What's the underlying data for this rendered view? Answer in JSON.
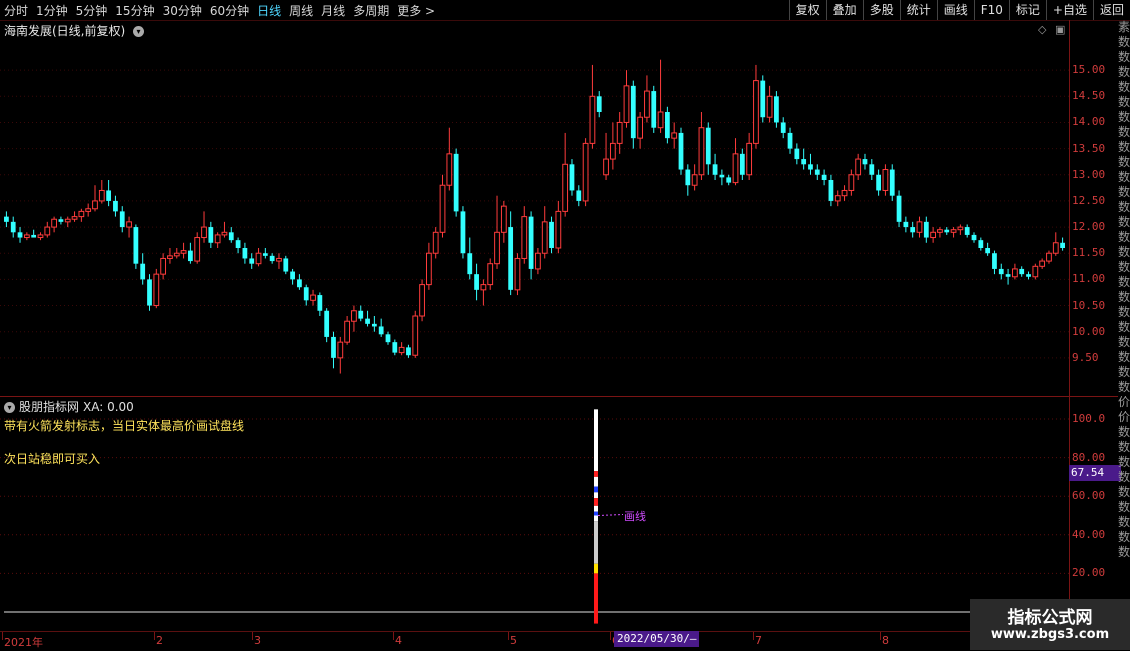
{
  "toolbar": {
    "periods": [
      "分时",
      "1分钟",
      "5分钟",
      "15分钟",
      "30分钟",
      "60分钟",
      "日线",
      "周线",
      "月线",
      "多周期",
      "更多 >"
    ],
    "active_period": "日线",
    "buttons": [
      "复权",
      "叠加",
      "多股",
      "统计",
      "画线",
      "F10",
      "标记",
      "+自选",
      "返回"
    ]
  },
  "main": {
    "title": "海南发展(日线,前复权)",
    "price_labels": [
      "15.00",
      "14.50",
      "14.00",
      "13.50",
      "13.00",
      "12.50",
      "12.00",
      "11.50",
      "11.00",
      "10.50",
      "10.00",
      "9.50"
    ],
    "up_color": "#ff3c3c",
    "down_color": "#33ffff"
  },
  "indicator": {
    "name": "股朋指标网",
    "xa_label": "XA: 0.00",
    "line1": "带有火箭发射标志，当日实体最高价画试盘线",
    "line2": "次日站稳即可买入",
    "axis_labels": [
      "100.0",
      "80.00",
      "60.00",
      "40.00",
      "20.00"
    ],
    "current_value": "67.54",
    "trial_line_label": "画线"
  },
  "date_axis": {
    "labels": [
      "2021年",
      "2",
      "3",
      "4",
      "5",
      "6",
      "7",
      "8"
    ],
    "crosshair_date": "2022/05/30/—"
  },
  "right_strip": [
    "素",
    "数",
    "数",
    "数",
    "数",
    "数",
    "数",
    "数",
    "数",
    "数",
    "数",
    "数",
    "数",
    "数",
    "数",
    "数",
    "数",
    "数",
    "数",
    "数",
    "数",
    "数",
    "数",
    "数",
    "数",
    "价",
    "价",
    "数",
    "数",
    "数",
    "数",
    "数",
    "数",
    "数",
    "数",
    "数"
  ],
  "watermark": {
    "title": "指标公式网",
    "url": "www.zbgs3.com"
  },
  "chart_data": {
    "type": "candlestick",
    "title": "海南发展(日线,前复权)",
    "ylim": [
      9.0,
      15.5
    ],
    "candles": [
      {
        "o": 12.2,
        "h": 12.3,
        "l": 12.0,
        "c": 12.1
      },
      {
        "o": 12.1,
        "h": 12.2,
        "l": 11.8,
        "c": 11.9
      },
      {
        "o": 11.9,
        "h": 12.0,
        "l": 11.7,
        "c": 11.8
      },
      {
        "o": 11.8,
        "h": 11.9,
        "l": 11.75,
        "c": 11.85
      },
      {
        "o": 11.85,
        "h": 11.95,
        "l": 11.8,
        "c": 11.8
      },
      {
        "o": 11.8,
        "h": 11.9,
        "l": 11.75,
        "c": 11.85
      },
      {
        "o": 11.85,
        "h": 12.1,
        "l": 11.8,
        "c": 12.0
      },
      {
        "o": 12.0,
        "h": 12.2,
        "l": 11.9,
        "c": 12.15
      },
      {
        "o": 12.15,
        "h": 12.2,
        "l": 12.05,
        "c": 12.1
      },
      {
        "o": 12.1,
        "h": 12.2,
        "l": 12.0,
        "c": 12.15
      },
      {
        "o": 12.15,
        "h": 12.3,
        "l": 12.1,
        "c": 12.2
      },
      {
        "o": 12.2,
        "h": 12.35,
        "l": 12.1,
        "c": 12.3
      },
      {
        "o": 12.3,
        "h": 12.45,
        "l": 12.2,
        "c": 12.35
      },
      {
        "o": 12.35,
        "h": 12.8,
        "l": 12.3,
        "c": 12.5
      },
      {
        "o": 12.5,
        "h": 12.9,
        "l": 12.45,
        "c": 12.7
      },
      {
        "o": 12.7,
        "h": 12.9,
        "l": 12.4,
        "c": 12.5
      },
      {
        "o": 12.5,
        "h": 12.6,
        "l": 12.2,
        "c": 12.3
      },
      {
        "o": 12.3,
        "h": 12.4,
        "l": 11.9,
        "c": 12.0
      },
      {
        "o": 12.0,
        "h": 12.2,
        "l": 11.8,
        "c": 12.1
      },
      {
        "o": 12.0,
        "h": 12.05,
        "l": 11.2,
        "c": 11.3
      },
      {
        "o": 11.3,
        "h": 11.5,
        "l": 10.9,
        "c": 11.0
      },
      {
        "o": 11.0,
        "h": 11.1,
        "l": 10.4,
        "c": 10.5
      },
      {
        "o": 10.5,
        "h": 11.2,
        "l": 10.45,
        "c": 11.1
      },
      {
        "o": 11.1,
        "h": 11.5,
        "l": 11.0,
        "c": 11.4
      },
      {
        "o": 11.4,
        "h": 11.6,
        "l": 11.3,
        "c": 11.45
      },
      {
        "o": 11.45,
        "h": 11.6,
        "l": 11.4,
        "c": 11.5
      },
      {
        "o": 11.5,
        "h": 11.7,
        "l": 11.4,
        "c": 11.55
      },
      {
        "o": 11.55,
        "h": 11.7,
        "l": 11.3,
        "c": 11.35
      },
      {
        "o": 11.35,
        "h": 11.9,
        "l": 11.3,
        "c": 11.8
      },
      {
        "o": 11.8,
        "h": 12.3,
        "l": 11.7,
        "c": 12.0
      },
      {
        "o": 12.0,
        "h": 12.1,
        "l": 11.6,
        "c": 11.7
      },
      {
        "o": 11.7,
        "h": 11.9,
        "l": 11.6,
        "c": 11.85
      },
      {
        "o": 11.85,
        "h": 12.1,
        "l": 11.8,
        "c": 11.9
      },
      {
        "o": 11.9,
        "h": 12.0,
        "l": 11.7,
        "c": 11.75
      },
      {
        "o": 11.75,
        "h": 11.8,
        "l": 11.5,
        "c": 11.6
      },
      {
        "o": 11.6,
        "h": 11.7,
        "l": 11.3,
        "c": 11.4
      },
      {
        "o": 11.4,
        "h": 11.5,
        "l": 11.2,
        "c": 11.3
      },
      {
        "o": 11.3,
        "h": 11.6,
        "l": 11.25,
        "c": 11.5
      },
      {
        "o": 11.5,
        "h": 11.6,
        "l": 11.4,
        "c": 11.45
      },
      {
        "o": 11.45,
        "h": 11.5,
        "l": 11.3,
        "c": 11.35
      },
      {
        "o": 11.35,
        "h": 11.5,
        "l": 11.2,
        "c": 11.4
      },
      {
        "o": 11.4,
        "h": 11.45,
        "l": 11.1,
        "c": 11.15
      },
      {
        "o": 11.15,
        "h": 11.2,
        "l": 10.9,
        "c": 11.0
      },
      {
        "o": 11.0,
        "h": 11.1,
        "l": 10.8,
        "c": 10.85
      },
      {
        "o": 10.85,
        "h": 10.9,
        "l": 10.5,
        "c": 10.6
      },
      {
        "o": 10.6,
        "h": 10.8,
        "l": 10.5,
        "c": 10.7
      },
      {
        "o": 10.7,
        "h": 10.75,
        "l": 10.3,
        "c": 10.4
      },
      {
        "o": 10.4,
        "h": 10.45,
        "l": 9.8,
        "c": 9.9
      },
      {
        "o": 9.9,
        "h": 10.0,
        "l": 9.3,
        "c": 9.5
      },
      {
        "o": 9.5,
        "h": 9.9,
        "l": 9.2,
        "c": 9.8
      },
      {
        "o": 9.8,
        "h": 10.3,
        "l": 9.75,
        "c": 10.2
      },
      {
        "o": 10.2,
        "h": 10.5,
        "l": 10.0,
        "c": 10.4
      },
      {
        "o": 10.4,
        "h": 10.5,
        "l": 10.2,
        "c": 10.25
      },
      {
        "o": 10.25,
        "h": 10.4,
        "l": 10.1,
        "c": 10.15
      },
      {
        "o": 10.15,
        "h": 10.3,
        "l": 10.0,
        "c": 10.1
      },
      {
        "o": 10.1,
        "h": 10.25,
        "l": 9.9,
        "c": 9.95
      },
      {
        "o": 9.95,
        "h": 10.0,
        "l": 9.75,
        "c": 9.8
      },
      {
        "o": 9.8,
        "h": 9.85,
        "l": 9.55,
        "c": 9.6
      },
      {
        "o": 9.6,
        "h": 9.8,
        "l": 9.55,
        "c": 9.7
      },
      {
        "o": 9.7,
        "h": 9.75,
        "l": 9.5,
        "c": 9.55
      },
      {
        "o": 9.55,
        "h": 10.4,
        "l": 9.5,
        "c": 10.3
      },
      {
        "o": 10.3,
        "h": 11.0,
        "l": 10.2,
        "c": 10.9
      },
      {
        "o": 10.9,
        "h": 11.7,
        "l": 10.8,
        "c": 11.5
      },
      {
        "o": 11.5,
        "h": 12.0,
        "l": 11.4,
        "c": 11.9
      },
      {
        "o": 11.9,
        "h": 13.0,
        "l": 11.8,
        "c": 12.8
      },
      {
        "o": 12.8,
        "h": 13.9,
        "l": 12.7,
        "c": 13.4
      },
      {
        "o": 13.4,
        "h": 13.5,
        "l": 12.2,
        "c": 12.3
      },
      {
        "o": 12.3,
        "h": 12.4,
        "l": 11.4,
        "c": 11.5
      },
      {
        "o": 11.5,
        "h": 11.8,
        "l": 11.0,
        "c": 11.1
      },
      {
        "o": 11.1,
        "h": 11.3,
        "l": 10.6,
        "c": 10.8
      },
      {
        "o": 10.8,
        "h": 11.0,
        "l": 10.5,
        "c": 10.9
      },
      {
        "o": 10.9,
        "h": 11.4,
        "l": 10.8,
        "c": 11.3
      },
      {
        "o": 11.3,
        "h": 12.6,
        "l": 11.2,
        "c": 11.9
      },
      {
        "o": 11.9,
        "h": 12.5,
        "l": 11.7,
        "c": 12.4
      },
      {
        "o": 12.0,
        "h": 12.3,
        "l": 10.7,
        "c": 10.8
      },
      {
        "o": 10.8,
        "h": 11.5,
        "l": 10.7,
        "c": 11.4
      },
      {
        "o": 11.4,
        "h": 12.4,
        "l": 11.3,
        "c": 12.2
      },
      {
        "o": 12.2,
        "h": 12.3,
        "l": 11.0,
        "c": 11.2
      },
      {
        "o": 11.2,
        "h": 11.6,
        "l": 11.1,
        "c": 11.5
      },
      {
        "o": 11.5,
        "h": 12.4,
        "l": 11.4,
        "c": 12.1
      },
      {
        "o": 12.1,
        "h": 12.2,
        "l": 11.5,
        "c": 11.6
      },
      {
        "o": 11.6,
        "h": 12.5,
        "l": 11.5,
        "c": 12.3
      },
      {
        "o": 12.3,
        "h": 13.8,
        "l": 12.2,
        "c": 13.2
      },
      {
        "o": 13.2,
        "h": 13.3,
        "l": 12.6,
        "c": 12.7
      },
      {
        "o": 12.7,
        "h": 12.8,
        "l": 12.4,
        "c": 12.5
      },
      {
        "o": 12.5,
        "h": 13.7,
        "l": 12.4,
        "c": 13.6
      },
      {
        "o": 13.6,
        "h": 15.1,
        "l": 13.5,
        "c": 14.5
      },
      {
        "o": 14.5,
        "h": 14.6,
        "l": 14.1,
        "c": 14.2
      },
      {
        "o": 13.0,
        "h": 13.8,
        "l": 12.9,
        "c": 13.3
      },
      {
        "o": 13.3,
        "h": 14.0,
        "l": 13.1,
        "c": 13.6
      },
      {
        "o": 13.6,
        "h": 14.2,
        "l": 13.4,
        "c": 14.0
      },
      {
        "o": 14.0,
        "h": 15.0,
        "l": 13.9,
        "c": 14.7
      },
      {
        "o": 14.7,
        "h": 14.8,
        "l": 13.5,
        "c": 13.7
      },
      {
        "o": 13.7,
        "h": 14.2,
        "l": 13.5,
        "c": 14.1
      },
      {
        "o": 14.1,
        "h": 14.9,
        "l": 14.0,
        "c": 14.6
      },
      {
        "o": 14.6,
        "h": 14.7,
        "l": 13.8,
        "c": 13.9
      },
      {
        "o": 13.9,
        "h": 15.2,
        "l": 13.8,
        "c": 14.2
      },
      {
        "o": 14.2,
        "h": 14.3,
        "l": 13.6,
        "c": 13.7
      },
      {
        "o": 13.7,
        "h": 14.0,
        "l": 13.5,
        "c": 13.8
      },
      {
        "o": 13.8,
        "h": 13.9,
        "l": 13.0,
        "c": 13.1
      },
      {
        "o": 13.1,
        "h": 13.2,
        "l": 12.6,
        "c": 12.8
      },
      {
        "o": 12.8,
        "h": 13.2,
        "l": 12.7,
        "c": 13.0
      },
      {
        "o": 13.0,
        "h": 14.2,
        "l": 12.9,
        "c": 13.9
      },
      {
        "o": 13.9,
        "h": 14.0,
        "l": 13.0,
        "c": 13.2
      },
      {
        "o": 13.2,
        "h": 13.4,
        "l": 12.9,
        "c": 13.0
      },
      {
        "o": 13.0,
        "h": 13.1,
        "l": 12.8,
        "c": 12.95
      },
      {
        "o": 12.95,
        "h": 13.0,
        "l": 12.8,
        "c": 12.85
      },
      {
        "o": 12.85,
        "h": 13.7,
        "l": 12.8,
        "c": 13.4
      },
      {
        "o": 13.4,
        "h": 13.5,
        "l": 12.9,
        "c": 13.0
      },
      {
        "o": 13.0,
        "h": 13.8,
        "l": 12.9,
        "c": 13.6
      },
      {
        "o": 13.6,
        "h": 15.1,
        "l": 13.5,
        "c": 14.8
      },
      {
        "o": 14.8,
        "h": 14.9,
        "l": 14.0,
        "c": 14.1
      },
      {
        "o": 14.1,
        "h": 14.7,
        "l": 14.0,
        "c": 14.5
      },
      {
        "o": 14.5,
        "h": 14.6,
        "l": 13.9,
        "c": 14.0
      },
      {
        "o": 14.0,
        "h": 14.1,
        "l": 13.7,
        "c": 13.8
      },
      {
        "o": 13.8,
        "h": 13.9,
        "l": 13.4,
        "c": 13.5
      },
      {
        "o": 13.5,
        "h": 13.6,
        "l": 13.2,
        "c": 13.3
      },
      {
        "o": 13.3,
        "h": 13.5,
        "l": 13.1,
        "c": 13.2
      },
      {
        "o": 13.2,
        "h": 13.4,
        "l": 13.0,
        "c": 13.1
      },
      {
        "o": 13.1,
        "h": 13.2,
        "l": 12.9,
        "c": 13.0
      },
      {
        "o": 13.0,
        "h": 13.1,
        "l": 12.8,
        "c": 12.9
      },
      {
        "o": 12.9,
        "h": 13.0,
        "l": 12.4,
        "c": 12.5
      },
      {
        "o": 12.5,
        "h": 12.7,
        "l": 12.4,
        "c": 12.6
      },
      {
        "o": 12.6,
        "h": 12.8,
        "l": 12.5,
        "c": 12.7
      },
      {
        "o": 12.7,
        "h": 13.1,
        "l": 12.6,
        "c": 13.0
      },
      {
        "o": 13.0,
        "h": 13.4,
        "l": 12.9,
        "c": 13.3
      },
      {
        "o": 13.3,
        "h": 13.4,
        "l": 13.1,
        "c": 13.2
      },
      {
        "o": 13.2,
        "h": 13.3,
        "l": 12.9,
        "c": 13.0
      },
      {
        "o": 13.0,
        "h": 13.1,
        "l": 12.6,
        "c": 12.7
      },
      {
        "o": 12.7,
        "h": 13.2,
        "l": 12.6,
        "c": 13.1
      },
      {
        "o": 13.1,
        "h": 13.2,
        "l": 12.5,
        "c": 12.6
      },
      {
        "o": 12.6,
        "h": 12.7,
        "l": 12.0,
        "c": 12.1
      },
      {
        "o": 12.1,
        "h": 12.2,
        "l": 11.9,
        "c": 12.0
      },
      {
        "o": 12.0,
        "h": 12.1,
        "l": 11.8,
        "c": 11.9
      },
      {
        "o": 11.9,
        "h": 12.2,
        "l": 11.8,
        "c": 12.1
      },
      {
        "o": 12.1,
        "h": 12.2,
        "l": 11.7,
        "c": 11.8
      },
      {
        "o": 11.8,
        "h": 12.0,
        "l": 11.7,
        "c": 11.9
      },
      {
        "o": 11.9,
        "h": 12.0,
        "l": 11.8,
        "c": 11.95
      },
      {
        "o": 11.95,
        "h": 12.0,
        "l": 11.85,
        "c": 11.9
      },
      {
        "o": 11.9,
        "h": 12.0,
        "l": 11.8,
        "c": 11.95
      },
      {
        "o": 11.95,
        "h": 12.05,
        "l": 11.85,
        "c": 12.0
      },
      {
        "o": 12.0,
        "h": 12.05,
        "l": 11.8,
        "c": 11.85
      },
      {
        "o": 11.85,
        "h": 11.9,
        "l": 11.7,
        "c": 11.75
      },
      {
        "o": 11.75,
        "h": 11.8,
        "l": 11.55,
        "c": 11.6
      },
      {
        "o": 11.6,
        "h": 11.7,
        "l": 11.45,
        "c": 11.5
      },
      {
        "o": 11.5,
        "h": 11.55,
        "l": 11.1,
        "c": 11.2
      },
      {
        "o": 11.2,
        "h": 11.3,
        "l": 11.0,
        "c": 11.1
      },
      {
        "o": 11.1,
        "h": 11.2,
        "l": 10.9,
        "c": 11.05
      },
      {
        "o": 11.05,
        "h": 11.3,
        "l": 11.0,
        "c": 11.2
      },
      {
        "o": 11.2,
        "h": 11.25,
        "l": 11.05,
        "c": 11.1
      },
      {
        "o": 11.1,
        "h": 11.15,
        "l": 11.0,
        "c": 11.05
      },
      {
        "o": 11.05,
        "h": 11.3,
        "l": 11.0,
        "c": 11.25
      },
      {
        "o": 11.25,
        "h": 11.4,
        "l": 11.2,
        "c": 11.35
      },
      {
        "o": 11.35,
        "h": 11.55,
        "l": 11.3,
        "c": 11.5
      },
      {
        "o": 11.5,
        "h": 11.9,
        "l": 11.45,
        "c": 11.7
      },
      {
        "o": 11.7,
        "h": 11.8,
        "l": 11.55,
        "c": 11.6
      }
    ],
    "indicator_bar": {
      "date": "2022/05/30",
      "top": 100,
      "bottom": 0,
      "trial_value": 50
    },
    "indicator_ylim": [
      0,
      108
    ]
  }
}
